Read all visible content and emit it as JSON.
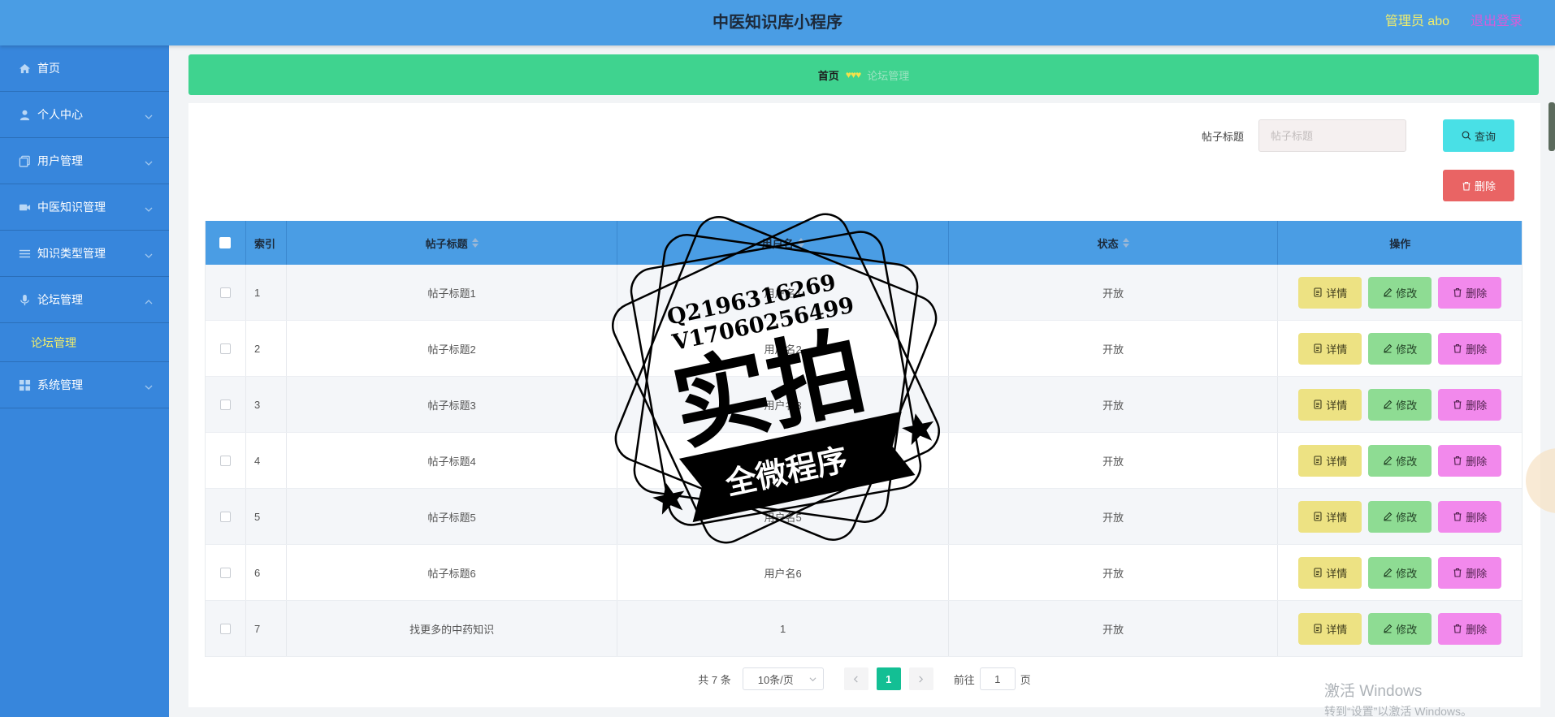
{
  "header": {
    "title": "中医知识库小程序",
    "user": "管理员 abo",
    "logout": "退出登录"
  },
  "sidebar": {
    "items": [
      {
        "label": "首页",
        "icon": "home-icon"
      },
      {
        "label": "个人中心",
        "icon": "user-icon"
      },
      {
        "label": "用户管理",
        "icon": "copy-icon"
      },
      {
        "label": "中医知识管理",
        "icon": "video-camera-icon"
      },
      {
        "label": "知识类型管理",
        "icon": "list-icon"
      },
      {
        "label": "论坛管理",
        "icon": "microphone-icon",
        "expanded": true
      },
      {
        "label": "系统管理",
        "icon": "grid-icon"
      }
    ],
    "sub_item": "论坛管理"
  },
  "breadcrumb": {
    "home": "首页",
    "separator": "♥♥♥",
    "current": "论坛管理"
  },
  "search": {
    "label": "帖子标题",
    "placeholder": "帖子标题",
    "query_button": "查询",
    "delete_button": "删除"
  },
  "table": {
    "columns": {
      "index": "索引",
      "title": "帖子标题",
      "user": "用户名",
      "status": "状态",
      "ops": "操作"
    },
    "rows": [
      {
        "index": "1",
        "title": "帖子标题1",
        "user": "用户名1",
        "status": "开放"
      },
      {
        "index": "2",
        "title": "帖子标题2",
        "user": "用户名2",
        "status": "开放"
      },
      {
        "index": "3",
        "title": "帖子标题3",
        "user": "用户名3",
        "status": "开放"
      },
      {
        "index": "4",
        "title": "帖子标题4",
        "user": "用户名4",
        "status": "开放"
      },
      {
        "index": "5",
        "title": "帖子标题5",
        "user": "用户名5",
        "status": "开放"
      },
      {
        "index": "6",
        "title": "帖子标题6",
        "user": "用户名6",
        "status": "开放"
      },
      {
        "index": "7",
        "title": "找更多的中药知识",
        "user": "1",
        "status": "开放"
      }
    ],
    "ops": {
      "detail": "详情",
      "edit": "修改",
      "delete": "删除"
    }
  },
  "pagination": {
    "total": "共 7 条",
    "page_size": "10条/页",
    "current_page": "1",
    "goto_prefix": "前往",
    "goto_value": "1",
    "goto_suffix": "页"
  },
  "watermark": {
    "qq": "Q2196316269",
    "wechat": "V17060256499",
    "big_text": "实拍",
    "ribbon": "全微程序"
  },
  "windows_watermark": {
    "line1": "激活 Windows",
    "line2": "转到“设置”以激活 Windows。"
  }
}
